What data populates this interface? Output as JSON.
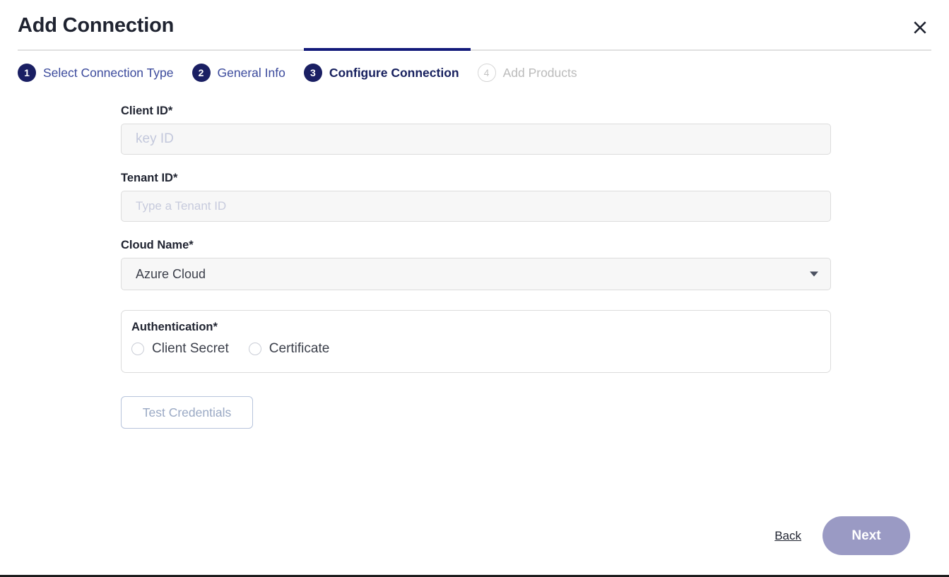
{
  "dialog": {
    "title": "Add Connection",
    "close_icon": "close-x-icon"
  },
  "stepper": {
    "steps": [
      {
        "number": "1",
        "label": "Select Connection Type",
        "state": "done"
      },
      {
        "number": "2",
        "label": "General Info",
        "state": "done"
      },
      {
        "number": "3",
        "label": "Configure Connection",
        "state": "current"
      },
      {
        "number": "4",
        "label": "Add Products",
        "state": "disabled"
      }
    ]
  },
  "form": {
    "client_id": {
      "label": "Client ID*",
      "placeholder": "key ID",
      "value": ""
    },
    "tenant_id": {
      "label": "Tenant ID*",
      "placeholder": "Type a Tenant ID",
      "value": ""
    },
    "cloud_name": {
      "label": "Cloud Name*",
      "selected": "Azure Cloud",
      "arrow_icon": "chevron-down-icon"
    },
    "authentication": {
      "label": "Authentication*",
      "options": [
        {
          "label": "Client Secret",
          "selected": false
        },
        {
          "label": "Certificate",
          "selected": false
        }
      ]
    },
    "test_credentials_label": "Test Credentials"
  },
  "footer": {
    "back_label": "Back",
    "next_label": "Next"
  },
  "colors": {
    "accent_navy": "#121a7a",
    "step_circle": "#1a1f63",
    "step_label": "#3b4a9c",
    "next_button": "#9a9ac4",
    "input_bg": "#f7f7f7",
    "border": "#dcdcdc"
  }
}
